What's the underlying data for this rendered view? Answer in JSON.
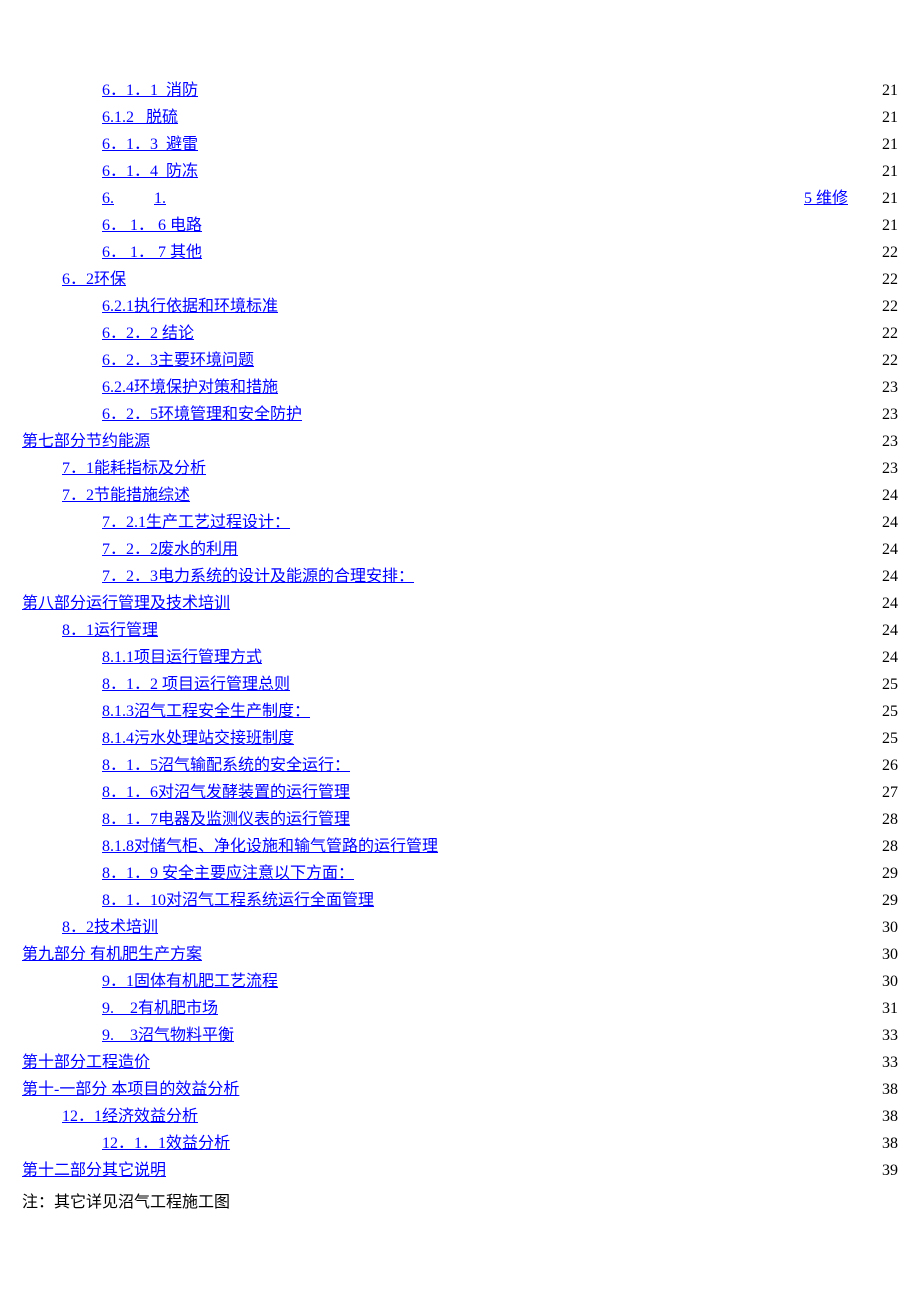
{
  "toc": [
    {
      "indent": 2,
      "label": "6．1．1  消防",
      "page": "21"
    },
    {
      "indent": 2,
      "label": "6.1.2   脱硫",
      "page": "21"
    },
    {
      "indent": 2,
      "label": "6．1．3  避雷",
      "page": "21"
    },
    {
      "indent": 2,
      "label": "6．1．4  防冻",
      "page": "21"
    },
    {
      "indent": 2,
      "special": true,
      "leftA": "6.",
      "leftB": "1.",
      "rightLink": "5 维修",
      "page": "21"
    },
    {
      "indent": 2,
      "label": "6． 1． 6 电路",
      "page": "21"
    },
    {
      "indent": 2,
      "label": "6． 1． 7 其他",
      "page": "22"
    },
    {
      "indent": 1,
      "label": "6．2环保",
      "page": "22"
    },
    {
      "indent": 2,
      "label": "6.2.1执行依据和环境标准",
      "page": "22"
    },
    {
      "indent": 2,
      "label": "6．2．2 结论",
      "page": "22"
    },
    {
      "indent": 2,
      "label": "6．2．3主要环境问题",
      "page": "22"
    },
    {
      "indent": 2,
      "label": "6.2.4环境保护对策和措施",
      "page": "23"
    },
    {
      "indent": 2,
      "label": "6．2．5环境管理和安全防护",
      "page": "23"
    },
    {
      "indent": 0,
      "label": "第七部分节约能源",
      "page": "23"
    },
    {
      "indent": 1,
      "label": "7．1能耗指标及分析",
      "page": "23"
    },
    {
      "indent": 1,
      "label": "7．2节能措施综述",
      "page": "24"
    },
    {
      "indent": 2,
      "label": "7．2.1生产工艺过程设计：",
      "page": "24"
    },
    {
      "indent": 2,
      "label": "7．2．2废水的利用",
      "page": "24"
    },
    {
      "indent": 2,
      "label": "7．2．3电力系统的设计及能源的合理安排：",
      "page": "24"
    },
    {
      "indent": 0,
      "label": "第八部分运行管理及技术培训",
      "page": "24"
    },
    {
      "indent": 1,
      "label": "8．1运行管理",
      "page": "24"
    },
    {
      "indent": 2,
      "label": "8.1.1项目运行管理方式",
      "page": "24"
    },
    {
      "indent": 2,
      "label": "8．1．2 项目运行管理总则",
      "page": "25"
    },
    {
      "indent": 2,
      "label": "8.1.3沼气工程安全生产制度：",
      "page": "25"
    },
    {
      "indent": 2,
      "label": "8.1.4污水处理站交接班制度",
      "page": "25"
    },
    {
      "indent": 2,
      "label": "8．1．5沼气输配系统的安全运行：",
      "page": "26"
    },
    {
      "indent": 2,
      "label": "8．1．6对沼气发酵装置的运行管理",
      "page": "27"
    },
    {
      "indent": 2,
      "label": "8．1．7电器及监测仪表的运行管理",
      "page": "28"
    },
    {
      "indent": 2,
      "label": "8.1.8对储气柜、净化设施和输气管路的运行管理",
      "page": "28"
    },
    {
      "indent": 2,
      "label": "8．1．9 安全主要应注意以下方面：",
      "page": "29"
    },
    {
      "indent": 2,
      "label": "8．1．10对沼气工程系统运行全面管理",
      "page": "29"
    },
    {
      "indent": 1,
      "label": "8．2技术培训",
      "page": "30"
    },
    {
      "indent": 0,
      "label": "第九部分 有机肥生产方案",
      "page": "30"
    },
    {
      "indent": 2,
      "label": "9．1固体有机肥工艺流程",
      "page": "30"
    },
    {
      "indent": 2,
      "label": "9.    2有机肥市场",
      "page": "31"
    },
    {
      "indent": 2,
      "label": "9.    3沼气物料平衡",
      "page": "33"
    },
    {
      "indent": 0,
      "label": "第十部分工程造价",
      "page": "33"
    },
    {
      "indent": 0,
      "label": "第十-一部分 本项目的效益分析",
      "page": "38"
    },
    {
      "indent": 1,
      "label": "12．1经济效益分析",
      "page": "38"
    },
    {
      "indent": 2,
      "label": "12．1．1效益分析",
      "page": "38"
    },
    {
      "indent": 0,
      "label": "第十二部分其它说明",
      "page": "39"
    }
  ],
  "note": "注：其它详见沼气工程施工图"
}
